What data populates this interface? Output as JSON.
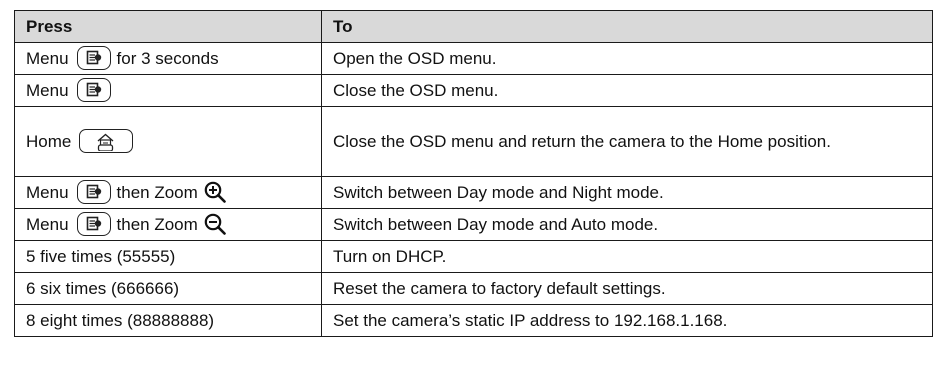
{
  "table": {
    "headers": {
      "press": "Press",
      "to": "To"
    },
    "rows": [
      {
        "press_prefix": "Menu",
        "press_suffix": "for 3 seconds",
        "to": "Open the OSD menu."
      },
      {
        "press_prefix": "Menu",
        "to": "Close the OSD menu."
      },
      {
        "press_prefix": "Home",
        "to": "Close the OSD menu and return the camera to the Home position."
      },
      {
        "press_prefix": "Menu",
        "press_suffix": "then Zoom",
        "to": "Switch between Day mode and Night mode."
      },
      {
        "press_prefix": "Menu",
        "press_suffix": "then Zoom",
        "to": "Switch between Day mode and Auto mode."
      },
      {
        "press_prefix": "5 five times (55555)",
        "to": "Turn on DHCP."
      },
      {
        "press_prefix": "6 six times (666666)",
        "to": "Reset the camera to factory default settings."
      },
      {
        "press_prefix": "8 eight times (88888888)",
        "to": "Set the camera’s static IP address to 192.168.1.168."
      }
    ]
  },
  "icons": {
    "menu_key": "menu-button-icon",
    "home_key": "home-button-icon",
    "zoom_in": "zoom-in-icon",
    "zoom_out": "zoom-out-icon"
  },
  "colors": {
    "header_bg": "#d9d9d9",
    "border": "#1a1a1a"
  }
}
